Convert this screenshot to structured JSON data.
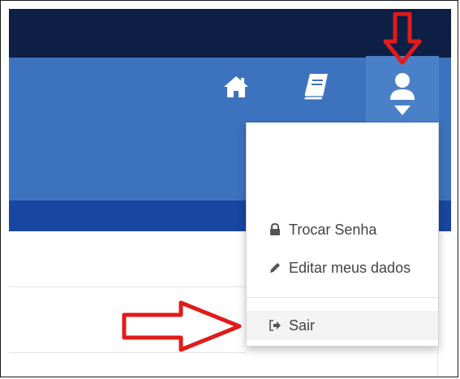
{
  "header": {
    "icons": {
      "home": "home-icon",
      "book": "book-icon",
      "user": "user-icon",
      "caret": "caret-down-icon"
    }
  },
  "user_menu": {
    "items": [
      {
        "label": "Trocar Senha",
        "icon": "lock-icon"
      },
      {
        "label": "Editar meus dados",
        "icon": "pencil-icon"
      },
      {
        "label": "Sair",
        "icon": "sign-out-icon"
      }
    ]
  },
  "annotations": {
    "arrow_color": "#e01b1b",
    "arrows": [
      "down-arrow",
      "right-arrow"
    ]
  },
  "colors": {
    "topbar": "#0d1f45",
    "header": "#3d73be",
    "subnav": "#1846a0"
  }
}
